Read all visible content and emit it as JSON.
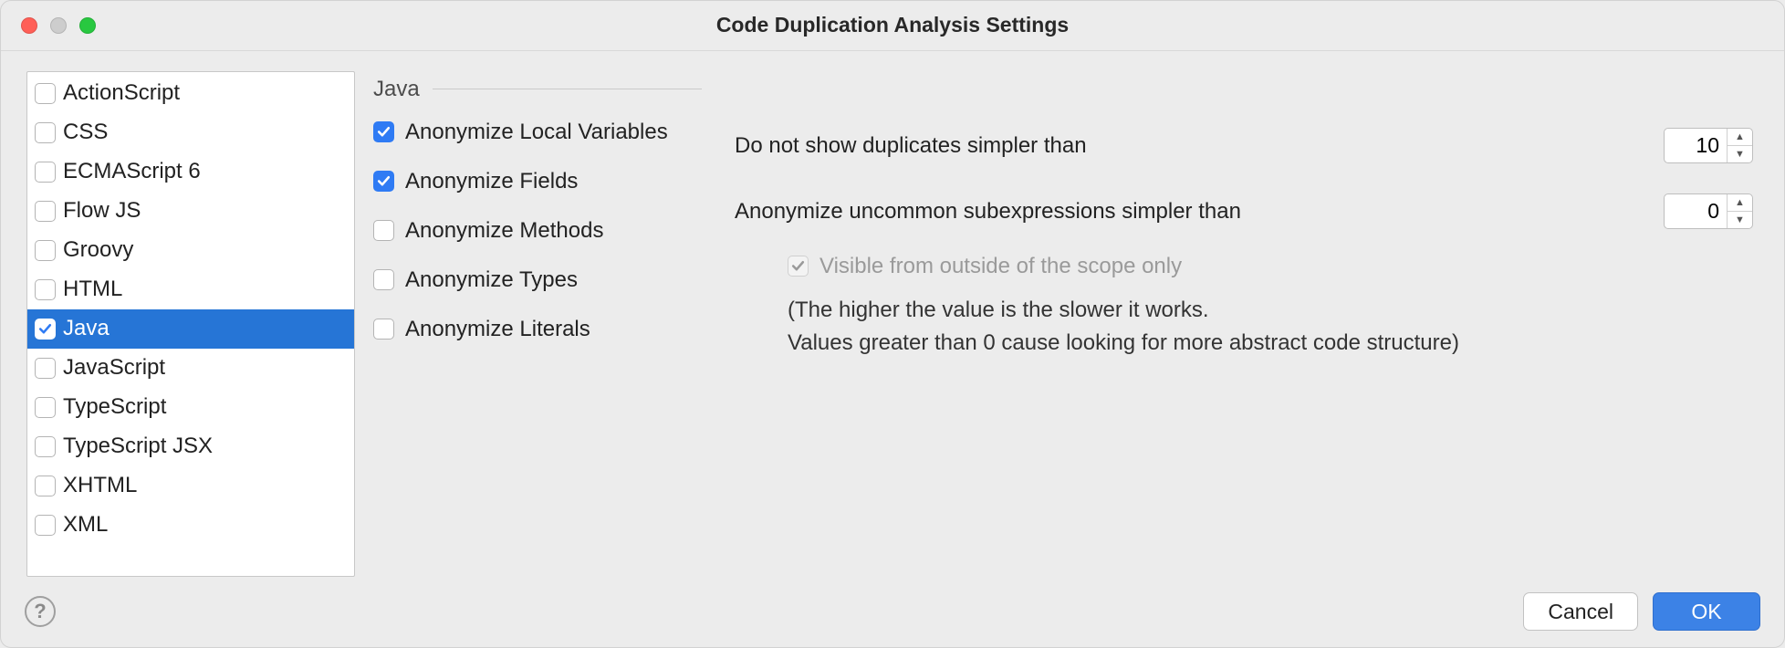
{
  "title": "Code Duplication Analysis Settings",
  "languages": [
    {
      "label": "ActionScript",
      "checked": false,
      "selected": false
    },
    {
      "label": "CSS",
      "checked": false,
      "selected": false
    },
    {
      "label": "ECMAScript 6",
      "checked": false,
      "selected": false
    },
    {
      "label": "Flow JS",
      "checked": false,
      "selected": false
    },
    {
      "label": "Groovy",
      "checked": false,
      "selected": false
    },
    {
      "label": "HTML",
      "checked": false,
      "selected": false
    },
    {
      "label": "Java",
      "checked": true,
      "selected": true
    },
    {
      "label": "JavaScript",
      "checked": false,
      "selected": false
    },
    {
      "label": "TypeScript",
      "checked": false,
      "selected": false
    },
    {
      "label": "TypeScript JSX",
      "checked": false,
      "selected": false
    },
    {
      "label": "XHTML",
      "checked": false,
      "selected": false
    },
    {
      "label": "XML",
      "checked": false,
      "selected": false
    }
  ],
  "section_title": "Java",
  "options": [
    {
      "label": "Anonymize Local Variables",
      "checked": true
    },
    {
      "label": "Anonymize Fields",
      "checked": true
    },
    {
      "label": "Anonymize Methods",
      "checked": false
    },
    {
      "label": "Anonymize Types",
      "checked": false
    },
    {
      "label": "Anonymize Literals",
      "checked": false
    }
  ],
  "duplicates_label": "Do not show duplicates simpler than",
  "duplicates_value": "10",
  "subexpr_label": "Anonymize uncommon subexpressions simpler than",
  "subexpr_value": "0",
  "scope_only_label": "Visible from outside of the scope only",
  "scope_only_checked": true,
  "scope_only_disabled": true,
  "note_line1": "(The higher the value is the slower it works.",
  "note_line2": "Values greater than 0 cause looking for more abstract code structure)",
  "help_glyph": "?",
  "cancel_label": "Cancel",
  "ok_label": "OK"
}
